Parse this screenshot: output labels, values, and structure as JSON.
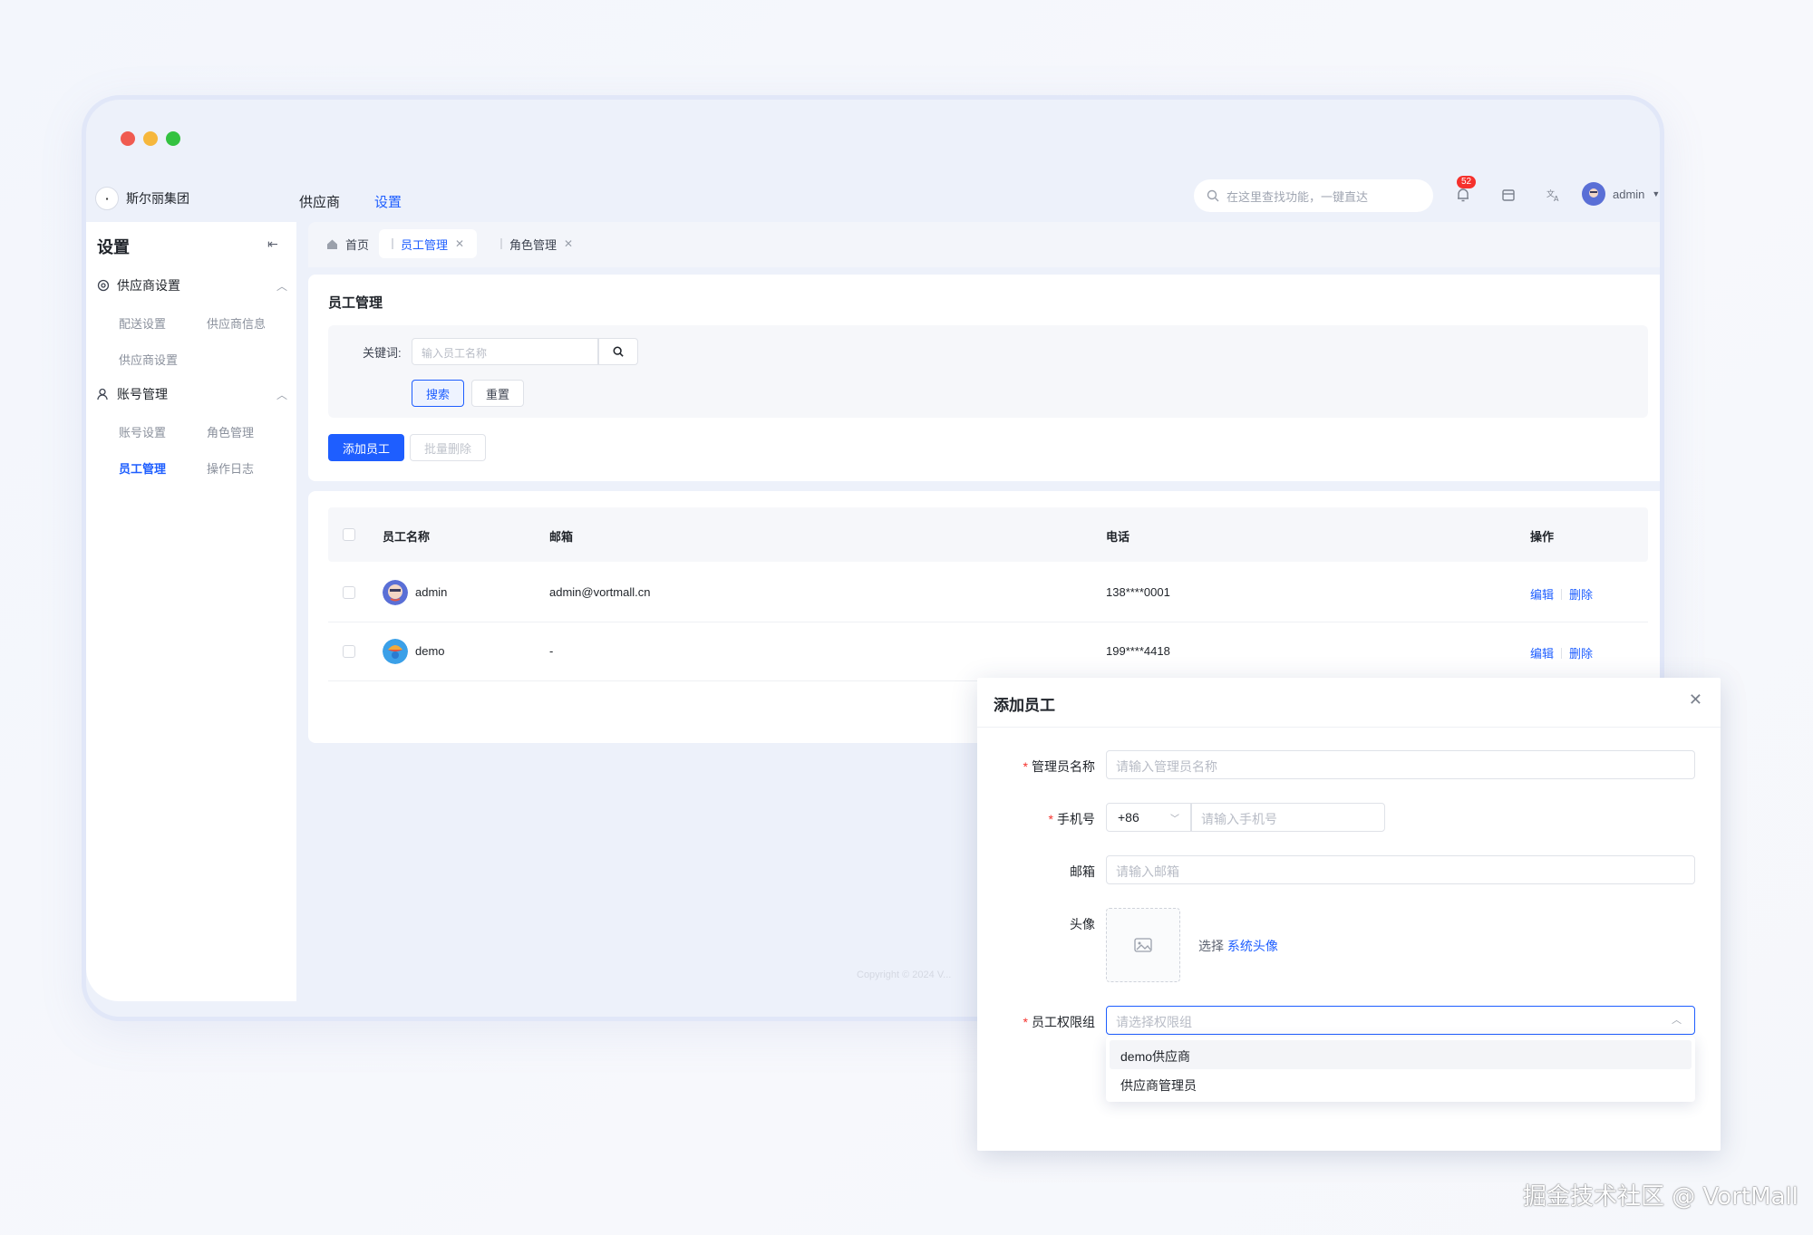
{
  "brand": {
    "name": "斯尔丽集团"
  },
  "nav": {
    "items": [
      "供应商",
      "设置"
    ],
    "active_index": 1
  },
  "search": {
    "placeholder": "在这里查找功能，一键直达"
  },
  "notifications": {
    "count": "52"
  },
  "user": {
    "name": "admin"
  },
  "sidebar": {
    "title": "设置",
    "groups": [
      {
        "label": "供应商设置",
        "icon": "settings-icon",
        "items": [
          "配送设置",
          "供应商信息",
          "供应商设置"
        ]
      },
      {
        "label": "账号管理",
        "icon": "user-icon",
        "items": [
          "账号设置",
          "角色管理",
          "员工管理",
          "操作日志"
        ]
      }
    ],
    "active_item": "员工管理"
  },
  "tabs": [
    {
      "label": "首页",
      "icon": "home-icon"
    },
    {
      "label": "员工管理",
      "active": true
    },
    {
      "label": "角色管理"
    }
  ],
  "filter": {
    "title": "员工管理",
    "keyword_label": "关键词:",
    "keyword_placeholder": "输入员工名称",
    "search_label": "搜索",
    "reset_label": "重置",
    "add_label": "添加员工",
    "batch_delete_label": "批量删除"
  },
  "table": {
    "columns": [
      "员工名称",
      "邮箱",
      "电话",
      "操作"
    ],
    "rows": [
      {
        "name": "admin",
        "email": "admin@vortmall.cn",
        "phone": "138****0001",
        "edit": "编辑",
        "delete": "删除"
      },
      {
        "name": "demo",
        "email": "-",
        "phone": "199****4418",
        "edit": "编辑",
        "delete": "删除"
      }
    ]
  },
  "footer": {
    "text": "Copyright © 2024 V..."
  },
  "modal": {
    "title": "添加员工",
    "fields": {
      "admin_name": {
        "label": "管理员名称",
        "required": true,
        "placeholder": "请输入管理员名称"
      },
      "phone": {
        "label": "手机号",
        "required": true,
        "prefix": "+86",
        "placeholder": "请输入手机号"
      },
      "email": {
        "label": "邮箱",
        "required": false,
        "placeholder": "请输入邮箱"
      },
      "avatar": {
        "label": "头像",
        "choose_text": "选择",
        "link_text": "系统头像"
      },
      "role_group": {
        "label": "员工权限组",
        "required": true,
        "placeholder": "请选择权限组"
      }
    },
    "role_options": [
      "demo供应商",
      "供应商管理员"
    ]
  },
  "watermark": "掘金技术社区 @ VortMall",
  "colors": {
    "accent": "#1e5eff",
    "danger": "#f5312c",
    "background": "#f3f6fc"
  }
}
